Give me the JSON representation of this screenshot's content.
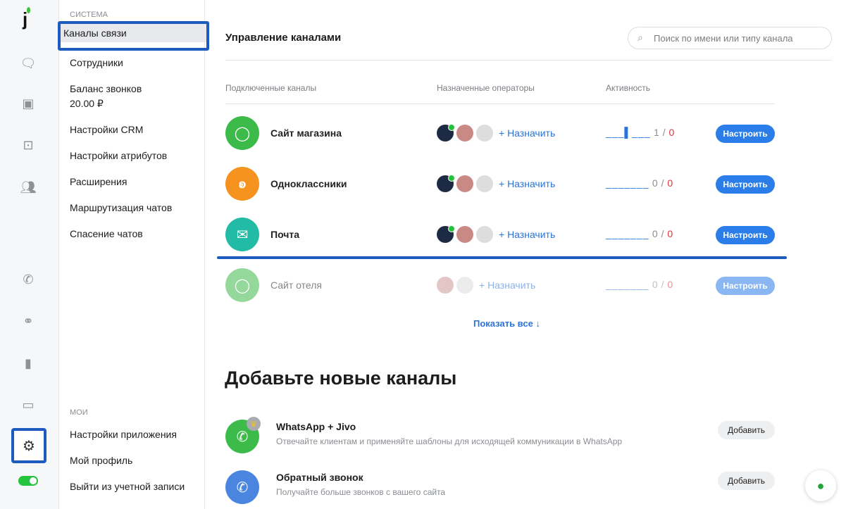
{
  "menu": {
    "section_system": "СИСТЕМА",
    "items": [
      "Каналы связи",
      "Сотрудники",
      "Баланс звонков",
      "20.00 ₽",
      "Настройки CRM",
      "Настройки атрибутов",
      "Расширения",
      "Маршрутизация чатов",
      "Спасение чатов"
    ],
    "section_mine": "МОИ",
    "mine": [
      "Настройки приложения",
      "Мой профиль",
      "Выйти из учетной записи"
    ]
  },
  "main": {
    "title": "Управление каналами",
    "search_placeholder": "Поиск по имени или типу канала",
    "headers": [
      "Подключенные каналы",
      "Назначенные операторы",
      "Активность"
    ],
    "channels": [
      {
        "name": "Сайт магазина",
        "assign": "+ Назначить",
        "activity": "___▌___",
        "count": "1",
        "slash": "/",
        "missed": "0",
        "button": "Настроить",
        "color": "#3dbb4a"
      },
      {
        "name": "Одноклассники",
        "assign": "+ Назначить",
        "activity": "_______",
        "count": "0",
        "slash": "/",
        "missed": "0",
        "button": "Настроить",
        "color": "#f6921e"
      },
      {
        "name": "Почта",
        "assign": "+ Назначить",
        "activity": "_______",
        "count": "0",
        "slash": "/",
        "missed": "0",
        "button": "Настроить",
        "color": "#22bba5"
      },
      {
        "name": "Сайт отеля",
        "assign": "+ Назначить",
        "activity": "_______",
        "count": "0",
        "slash": "/",
        "missed": "0",
        "button": "Настроить",
        "color": "#3dbb4a"
      }
    ],
    "show_all": "Показать все ↓",
    "add_title": "Добавьте новые каналы",
    "new_channels": [
      {
        "title": "WhatsApp + Jivo",
        "desc": "Отвечайте клиентам и применяйте шаблоны для исходящей коммуникации в WhatsApp",
        "button": "Добавить"
      },
      {
        "title": "Обратный звонок",
        "desc": "Получайте больше звонков с вашего сайта",
        "button": "Добавить"
      }
    ]
  }
}
